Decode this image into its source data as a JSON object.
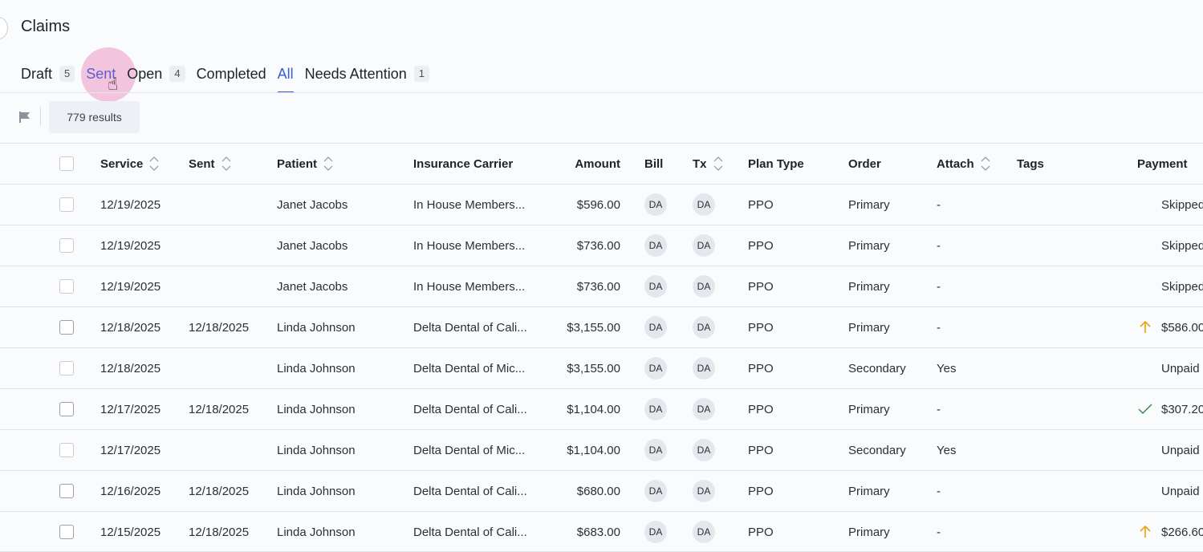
{
  "page": {
    "title": "Claims"
  },
  "tabs": [
    {
      "label": "Draft",
      "count": "5"
    },
    {
      "label": "Sent",
      "count": ""
    },
    {
      "label": "Open",
      "count": "4"
    },
    {
      "label": "Completed",
      "count": ""
    },
    {
      "label": "All",
      "count": ""
    },
    {
      "label": "Needs Attention",
      "count": "1"
    }
  ],
  "active_tab": "All",
  "toolbar": {
    "results": "779 results"
  },
  "columns": [
    "Service",
    "Sent",
    "Patient",
    "Insurance Carrier",
    "Amount",
    "Bill",
    "Tx",
    "Plan Type",
    "Order",
    "Attach",
    "Tags",
    "Payment"
  ],
  "rows": [
    {
      "service": "12/19/2025",
      "sent": "",
      "patient": "Janet Jacobs",
      "carrier": "In House Members...",
      "amount": "$596.00",
      "bill": "DA",
      "tx": "DA",
      "plan": "PPO",
      "order": "Primary",
      "attach": "-",
      "tags": "",
      "payment": "Skipped",
      "pay_icon": "",
      "checkbox_dim": true
    },
    {
      "service": "12/19/2025",
      "sent": "",
      "patient": "Janet Jacobs",
      "carrier": "In House Members...",
      "amount": "$736.00",
      "bill": "DA",
      "tx": "DA",
      "plan": "PPO",
      "order": "Primary",
      "attach": "-",
      "tags": "",
      "payment": "Skipped",
      "pay_icon": "",
      "checkbox_dim": true
    },
    {
      "service": "12/19/2025",
      "sent": "",
      "patient": "Janet Jacobs",
      "carrier": "In House Members...",
      "amount": "$736.00",
      "bill": "DA",
      "tx": "DA",
      "plan": "PPO",
      "order": "Primary",
      "attach": "-",
      "tags": "",
      "payment": "Skipped",
      "pay_icon": "",
      "checkbox_dim": true
    },
    {
      "service": "12/18/2025",
      "sent": "12/18/2025",
      "patient": "Linda Johnson",
      "carrier": "Delta Dental of Cali...",
      "amount": "$3,155.00",
      "bill": "DA",
      "tx": "DA",
      "plan": "PPO",
      "order": "Primary",
      "attach": "-",
      "tags": "",
      "payment": "$586.00",
      "pay_icon": "arrow-up-icon",
      "checkbox_dim": false
    },
    {
      "service": "12/18/2025",
      "sent": "",
      "patient": "Linda Johnson",
      "carrier": "Delta Dental of Mic...",
      "amount": "$3,155.00",
      "bill": "DA",
      "tx": "DA",
      "plan": "PPO",
      "order": "Secondary",
      "attach": "Yes",
      "tags": "",
      "payment": "Unpaid",
      "pay_icon": "",
      "checkbox_dim": true
    },
    {
      "service": "12/17/2025",
      "sent": "12/18/2025",
      "patient": "Linda Johnson",
      "carrier": "Delta Dental of Cali...",
      "amount": "$1,104.00",
      "bill": "DA",
      "tx": "DA",
      "plan": "PPO",
      "order": "Primary",
      "attach": "-",
      "tags": "",
      "payment": "$307.20",
      "pay_icon": "check-icon",
      "checkbox_dim": false
    },
    {
      "service": "12/17/2025",
      "sent": "",
      "patient": "Linda Johnson",
      "carrier": "Delta Dental of Mic...",
      "amount": "$1,104.00",
      "bill": "DA",
      "tx": "DA",
      "plan": "PPO",
      "order": "Secondary",
      "attach": "Yes",
      "tags": "",
      "payment": "Unpaid",
      "pay_icon": "",
      "checkbox_dim": true
    },
    {
      "service": "12/16/2025",
      "sent": "12/18/2025",
      "patient": "Linda Johnson",
      "carrier": "Delta Dental of Cali...",
      "amount": "$680.00",
      "bill": "DA",
      "tx": "DA",
      "plan": "PPO",
      "order": "Primary",
      "attach": "-",
      "tags": "",
      "payment": "Unpaid",
      "pay_icon": "",
      "checkbox_dim": false
    },
    {
      "service": "12/15/2025",
      "sent": "12/18/2025",
      "patient": "Linda Johnson",
      "carrier": "Delta Dental of Cali...",
      "amount": "$683.00",
      "bill": "DA",
      "tx": "DA",
      "plan": "PPO",
      "order": "Primary",
      "attach": "-",
      "tags": "",
      "payment": "$266.60",
      "pay_icon": "arrow-up-icon",
      "checkbox_dim": false
    }
  ],
  "colors": {
    "accent": "#3a5bd9",
    "warning": "#e8a317",
    "success": "#3d8b4f"
  }
}
